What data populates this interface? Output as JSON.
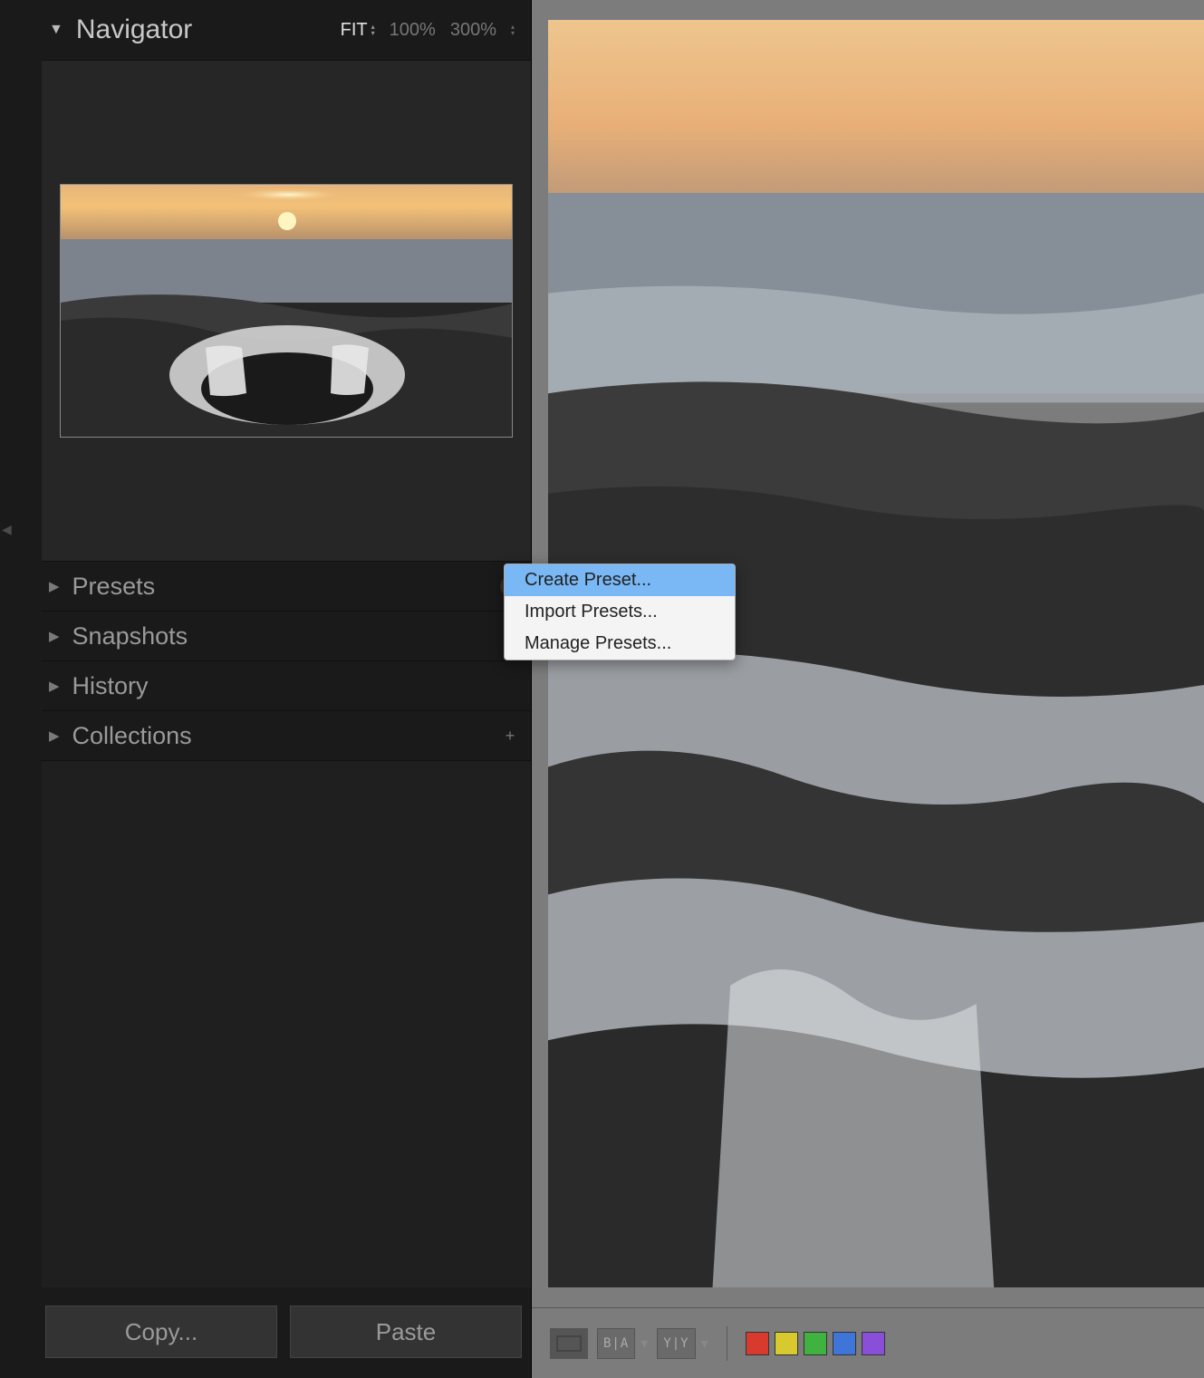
{
  "navigator": {
    "title": "Navigator",
    "zoom_fit": "FIT",
    "zoom_100": "100%",
    "zoom_300": "300%"
  },
  "panels": {
    "presets": "Presets",
    "snapshots": "Snapshots",
    "history": "History",
    "collections": "Collections"
  },
  "buttons": {
    "copy": "Copy...",
    "paste": "Paste"
  },
  "context_menu": {
    "create": "Create Preset...",
    "import": "Import Presets...",
    "manage": "Manage Presets..."
  },
  "toolbar": {
    "compare_ba": "B|A",
    "compare_yy": "Y|Y"
  },
  "colors": {
    "red": "#d83a2e",
    "yellow": "#d8c92e",
    "green": "#3fb23f",
    "blue": "#3f74d8",
    "purple": "#8a4fd8"
  }
}
